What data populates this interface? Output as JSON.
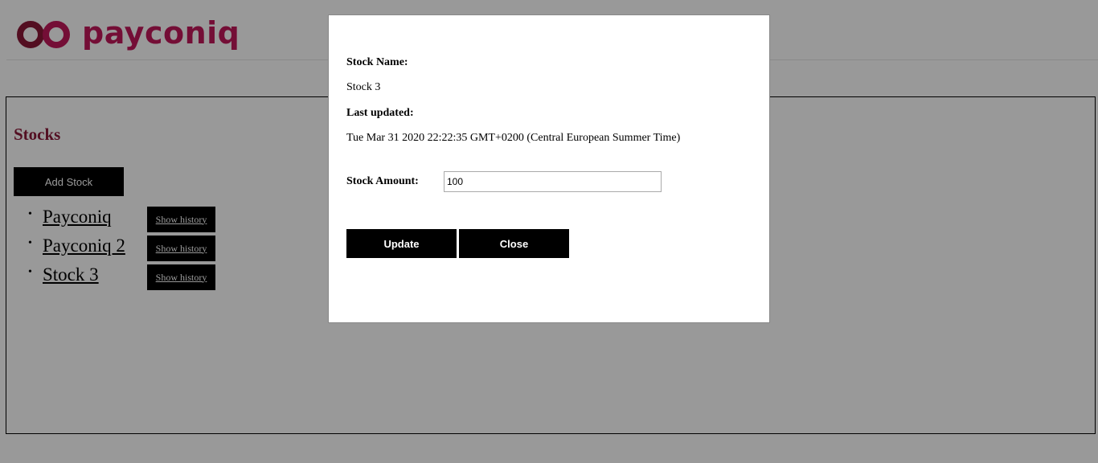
{
  "brand": {
    "name": "payconiq",
    "color": "#c2185b"
  },
  "stocks_panel": {
    "title": "Stocks",
    "add_button": "Add Stock",
    "items": [
      {
        "name": "Payconiq",
        "history_button": "Show history"
      },
      {
        "name": "Payconiq 2",
        "history_button": "Show history"
      },
      {
        "name": "Stock 3",
        "history_button": "Show history"
      }
    ]
  },
  "modal": {
    "stock_name_label": "Stock Name:",
    "stock_name_value": "Stock 3",
    "last_updated_label": "Last updated:",
    "last_updated_value": "Tue Mar 31 2020 22:22:35 GMT+0200 (Central European Summer Time)",
    "amount_label": "Stock Amount:",
    "amount_value": "100",
    "update_button": "Update",
    "close_button": "Close"
  }
}
